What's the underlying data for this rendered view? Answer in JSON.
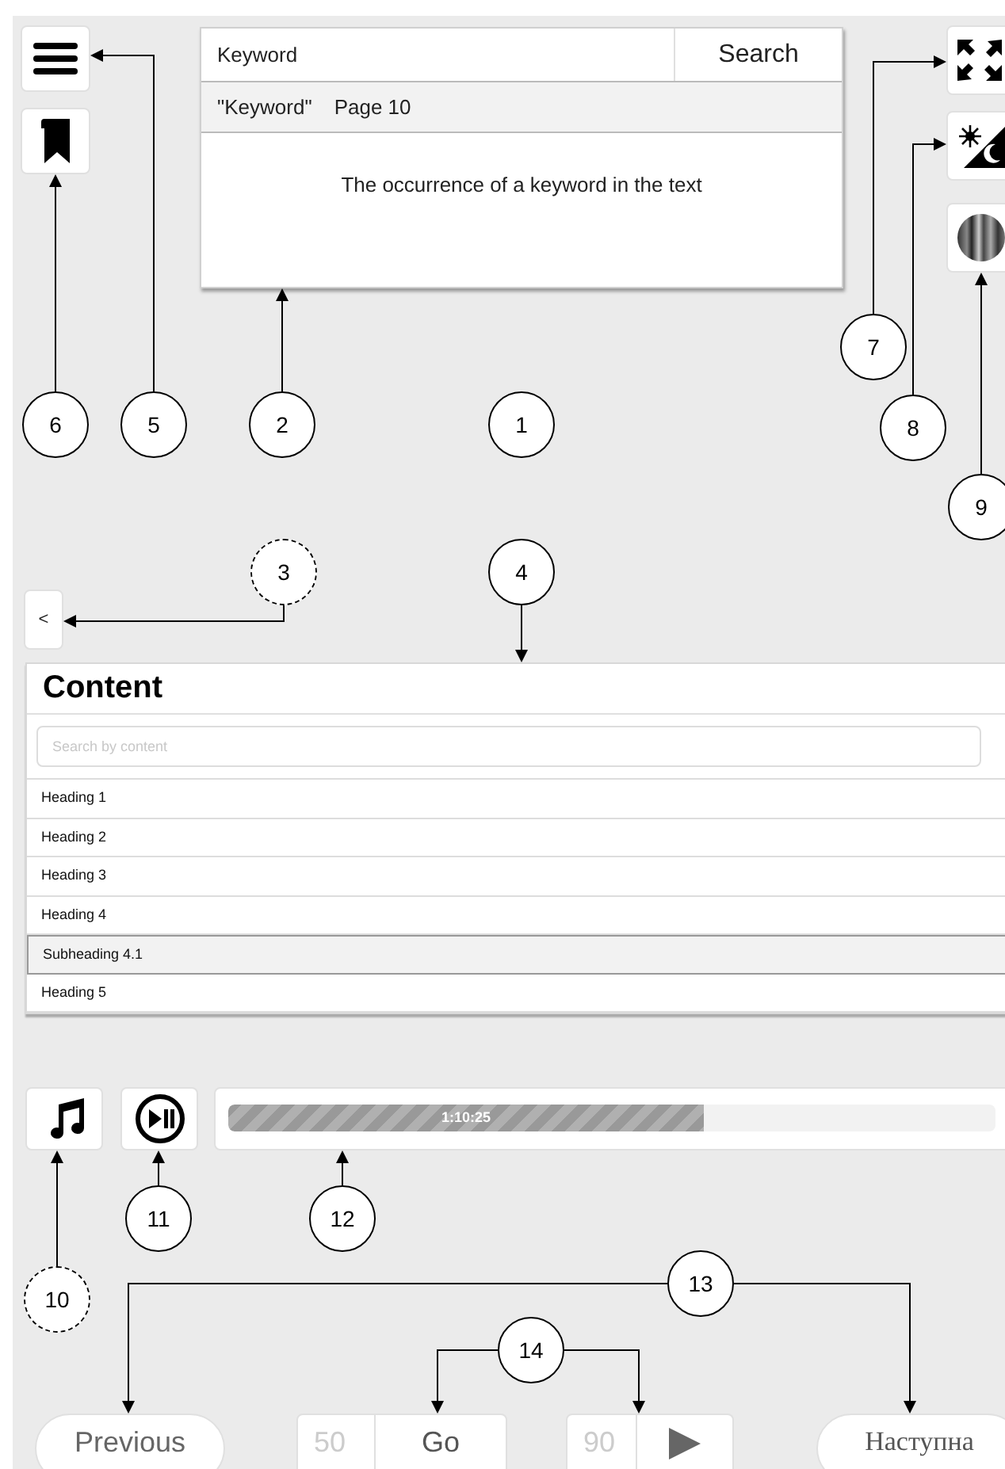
{
  "search_panel": {
    "input_value": "Keyword",
    "button": "Search",
    "result_keyword": "\"Keyword\"",
    "result_page": "Page 10",
    "body": "The occurrence of a keyword in the text"
  },
  "content_panel": {
    "title": "Content",
    "search_placeholder": "Search by content",
    "items": [
      {
        "label": "Heading 1",
        "selected": false
      },
      {
        "label": "Heading 2",
        "selected": false
      },
      {
        "label": "Heading 3",
        "selected": false
      },
      {
        "label": "Heading 4",
        "selected": false
      },
      {
        "label": "Subheading 4.1",
        "selected": true
      },
      {
        "label": "Heading 5",
        "selected": false
      }
    ]
  },
  "collapse_button": "<",
  "audio": {
    "level": 0.62,
    "time": "1:10:25"
  },
  "navigation": {
    "previous": "Previous",
    "from_placeholder": "50",
    "go": "Go",
    "to_placeholder": "90",
    "next": "Наступна"
  },
  "callouts": [
    {
      "number": "7",
      "dashed": false
    },
    {
      "number": "6",
      "dashed": false
    },
    {
      "number": "5",
      "dashed": false
    },
    {
      "number": "2",
      "dashed": false
    },
    {
      "number": "1",
      "dashed": false
    },
    {
      "number": "8",
      "dashed": false
    },
    {
      "number": "9",
      "dashed": false
    },
    {
      "number": "3",
      "dashed": true
    },
    {
      "number": "4",
      "dashed": false
    },
    {
      "number": "11",
      "dashed": false
    },
    {
      "number": "12",
      "dashed": false
    },
    {
      "number": "13",
      "dashed": false
    },
    {
      "number": "10",
      "dashed": true
    },
    {
      "number": "14",
      "dashed": false
    }
  ]
}
